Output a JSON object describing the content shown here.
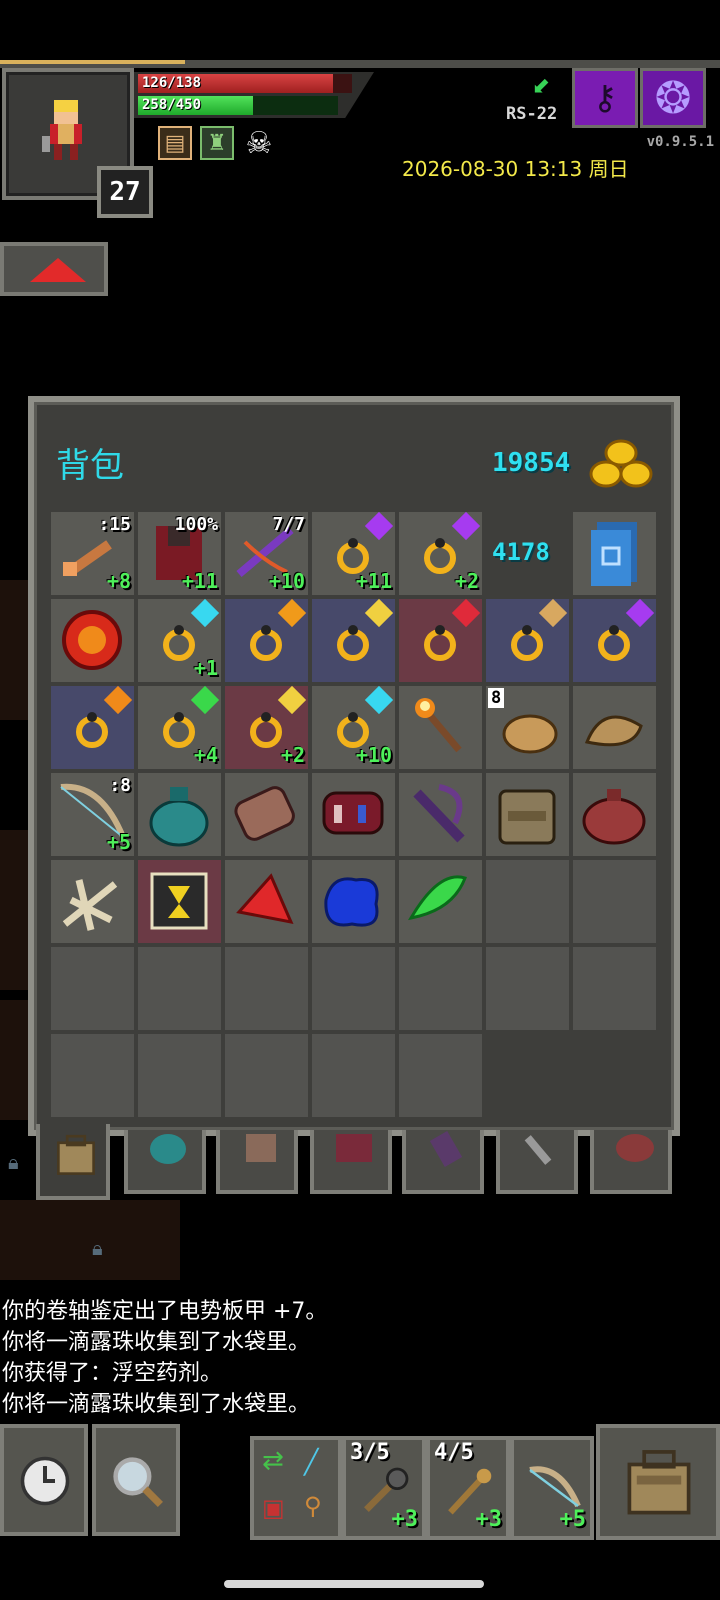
{
  "status": {
    "hp_text": "126/138",
    "hp_fraction": 0.913,
    "shield_text": "258/450",
    "shield_fraction": 0.573,
    "level": "27",
    "depth_label": "RS-22",
    "version": "v0.9.5.1",
    "datetime": "2026-08-30 13:13 周日",
    "buffs": [
      "scroll-buff-icon",
      "plant-buff-icon",
      "skull-buff-icon"
    ]
  },
  "bag": {
    "title": "背包",
    "gold": "19854",
    "row1_special_count": "4178",
    "slots": [
      {
        "icon": "wand-icon",
        "tl": ":15",
        "lvl": "+8",
        "bg": "normal"
      },
      {
        "icon": "armor-icon",
        "tl": "100%",
        "lvl": "+11",
        "bg": "normal"
      },
      {
        "icon": "crossbow-icon",
        "tl": "7/7",
        "lvl": "+10",
        "bg": "normal"
      },
      {
        "icon": "ring-gold-icon",
        "tl": "",
        "lvl": "+11",
        "bg": "normal",
        "gem": "purple"
      },
      {
        "icon": "ring-gold-icon",
        "tl": "",
        "lvl": "+2",
        "bg": "normal",
        "gem": "purple"
      },
      {
        "icon": "count-cell",
        "tl": "",
        "lvl": "",
        "bg": "normal"
      },
      {
        "icon": "blue-book-icon",
        "tl": "",
        "lvl": "",
        "bg": "normal"
      },
      {
        "icon": "red-orb-icon",
        "tl": "",
        "lvl": "",
        "bg": "normal"
      },
      {
        "icon": "ring-gold-icon",
        "tl": "",
        "lvl": "+1",
        "bg": "normal",
        "gem": "cyan"
      },
      {
        "icon": "ring-gold-icon",
        "tl": "",
        "lvl": "",
        "bg": "blue",
        "gem": "orange"
      },
      {
        "icon": "ring-gold-icon",
        "tl": "",
        "lvl": "",
        "bg": "blue",
        "gem": "yellow"
      },
      {
        "icon": "ring-gold-icon",
        "tl": "",
        "lvl": "",
        "bg": "red",
        "gem": "red"
      },
      {
        "icon": "ring-gold-icon",
        "tl": "",
        "lvl": "",
        "bg": "blue",
        "gem": "bow"
      },
      {
        "icon": "ring-gold-icon",
        "tl": "",
        "lvl": "",
        "bg": "blue",
        "gem": "purple"
      },
      {
        "icon": "ring-gold-icon",
        "tl": "",
        "lvl": "",
        "bg": "blue",
        "gem": "orange-arrow"
      },
      {
        "icon": "ring-gold-icon",
        "tl": "",
        "lvl": "+4",
        "bg": "normal",
        "gem": "green-arrow"
      },
      {
        "icon": "ring-gold-icon",
        "tl": "",
        "lvl": "+2",
        "bg": "red",
        "gem": "yellow"
      },
      {
        "icon": "ring-gold-icon",
        "tl": "",
        "lvl": "+10",
        "bg": "normal",
        "gem": "cyan"
      },
      {
        "icon": "torch-icon",
        "tl": "",
        "lvl": "",
        "bg": "normal"
      },
      {
        "icon": "food-ration-icon",
        "qty": "8",
        "tl": "",
        "lvl": "",
        "bg": "normal"
      },
      {
        "icon": "pasty-icon",
        "tl": "",
        "lvl": "",
        "bg": "normal"
      },
      {
        "icon": "bow-icon",
        "tl": ":8",
        "lvl": "+5",
        "bg": "normal"
      },
      {
        "icon": "seed-pouch-icon",
        "tl": "",
        "lvl": "",
        "bg": "normal"
      },
      {
        "icon": "scroll-holder-icon",
        "tl": "",
        "lvl": "",
        "bg": "normal"
      },
      {
        "icon": "potion-bandolier-icon",
        "tl": "",
        "lvl": "",
        "bg": "normal"
      },
      {
        "icon": "wand-holster-icon",
        "tl": "",
        "lvl": "",
        "bg": "normal"
      },
      {
        "icon": "backpack-item-icon",
        "tl": "",
        "lvl": "",
        "bg": "normal"
      },
      {
        "icon": "red-bag-icon",
        "tl": "",
        "lvl": "",
        "bg": "normal"
      },
      {
        "icon": "bones-icon",
        "tl": "",
        "lvl": "",
        "bg": "normal"
      },
      {
        "icon": "spellbook-icon",
        "tl": "",
        "lvl": "",
        "bg": "red"
      },
      {
        "icon": "red-crystal-icon",
        "tl": "",
        "lvl": "",
        "bg": "normal"
      },
      {
        "icon": "blue-goo-icon",
        "tl": "",
        "lvl": "",
        "bg": "normal"
      },
      {
        "icon": "green-leaves-icon",
        "tl": "",
        "lvl": "",
        "bg": "normal"
      },
      {
        "icon": "empty",
        "tl": "",
        "lvl": "",
        "bg": "empty"
      },
      {
        "icon": "empty",
        "tl": "",
        "lvl": "",
        "bg": "empty"
      }
    ]
  },
  "log": [
    "你的卷轴鉴定出了电势板甲 +7。",
    "你将一滴露珠收集到了水袋里。",
    "你获得了：浮空药剂。",
    "你将一滴露珠收集到了水袋里。"
  ],
  "quickslots": [
    {
      "icon": "mace-icon",
      "tl": "3/5",
      "lvl": "+3"
    },
    {
      "icon": "staff-icon",
      "tl": "4/5",
      "lvl": "+3"
    },
    {
      "icon": "bow-icon",
      "tl": "",
      "lvl": "+5"
    }
  ]
}
